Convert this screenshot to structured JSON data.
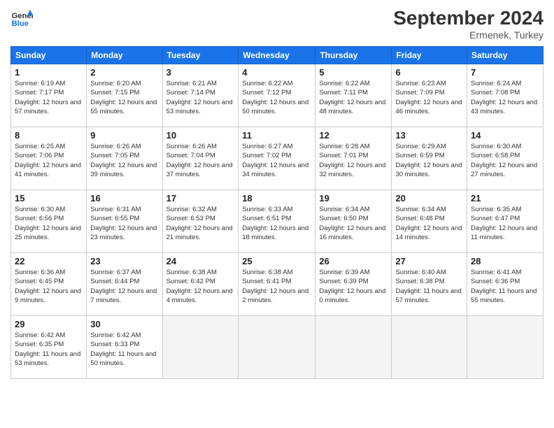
{
  "header": {
    "logo_line1": "General",
    "logo_line2": "Blue",
    "month_title": "September 2024",
    "location": "Ermenek, Turkey"
  },
  "weekdays": [
    "Sunday",
    "Monday",
    "Tuesday",
    "Wednesday",
    "Thursday",
    "Friday",
    "Saturday"
  ],
  "days": [
    {
      "num": "1",
      "sunrise": "6:19 AM",
      "sunset": "7:17 PM",
      "daylight": "12 hours and 57 minutes."
    },
    {
      "num": "2",
      "sunrise": "6:20 AM",
      "sunset": "7:15 PM",
      "daylight": "12 hours and 55 minutes."
    },
    {
      "num": "3",
      "sunrise": "6:21 AM",
      "sunset": "7:14 PM",
      "daylight": "12 hours and 53 minutes."
    },
    {
      "num": "4",
      "sunrise": "6:22 AM",
      "sunset": "7:12 PM",
      "daylight": "12 hours and 50 minutes."
    },
    {
      "num": "5",
      "sunrise": "6:22 AM",
      "sunset": "7:11 PM",
      "daylight": "12 hours and 48 minutes."
    },
    {
      "num": "6",
      "sunrise": "6:23 AM",
      "sunset": "7:09 PM",
      "daylight": "12 hours and 46 minutes."
    },
    {
      "num": "7",
      "sunrise": "6:24 AM",
      "sunset": "7:08 PM",
      "daylight": "12 hours and 43 minutes."
    },
    {
      "num": "8",
      "sunrise": "6:25 AM",
      "sunset": "7:06 PM",
      "daylight": "12 hours and 41 minutes."
    },
    {
      "num": "9",
      "sunrise": "6:26 AM",
      "sunset": "7:05 PM",
      "daylight": "12 hours and 39 minutes."
    },
    {
      "num": "10",
      "sunrise": "6:26 AM",
      "sunset": "7:04 PM",
      "daylight": "12 hours and 37 minutes."
    },
    {
      "num": "11",
      "sunrise": "6:27 AM",
      "sunset": "7:02 PM",
      "daylight": "12 hours and 34 minutes."
    },
    {
      "num": "12",
      "sunrise": "6:28 AM",
      "sunset": "7:01 PM",
      "daylight": "12 hours and 32 minutes."
    },
    {
      "num": "13",
      "sunrise": "6:29 AM",
      "sunset": "6:59 PM",
      "daylight": "12 hours and 30 minutes."
    },
    {
      "num": "14",
      "sunrise": "6:30 AM",
      "sunset": "6:58 PM",
      "daylight": "12 hours and 27 minutes."
    },
    {
      "num": "15",
      "sunrise": "6:30 AM",
      "sunset": "6:56 PM",
      "daylight": "12 hours and 25 minutes."
    },
    {
      "num": "16",
      "sunrise": "6:31 AM",
      "sunset": "6:55 PM",
      "daylight": "12 hours and 23 minutes."
    },
    {
      "num": "17",
      "sunrise": "6:32 AM",
      "sunset": "6:53 PM",
      "daylight": "12 hours and 21 minutes."
    },
    {
      "num": "18",
      "sunrise": "6:33 AM",
      "sunset": "6:51 PM",
      "daylight": "12 hours and 18 minutes."
    },
    {
      "num": "19",
      "sunrise": "6:34 AM",
      "sunset": "6:50 PM",
      "daylight": "12 hours and 16 minutes."
    },
    {
      "num": "20",
      "sunrise": "6:34 AM",
      "sunset": "6:48 PM",
      "daylight": "12 hours and 14 minutes."
    },
    {
      "num": "21",
      "sunrise": "6:35 AM",
      "sunset": "6:47 PM",
      "daylight": "12 hours and 11 minutes."
    },
    {
      "num": "22",
      "sunrise": "6:36 AM",
      "sunset": "6:45 PM",
      "daylight": "12 hours and 9 minutes."
    },
    {
      "num": "23",
      "sunrise": "6:37 AM",
      "sunset": "6:44 PM",
      "daylight": "12 hours and 7 minutes."
    },
    {
      "num": "24",
      "sunrise": "6:38 AM",
      "sunset": "6:42 PM",
      "daylight": "12 hours and 4 minutes."
    },
    {
      "num": "25",
      "sunrise": "6:38 AM",
      "sunset": "6:41 PM",
      "daylight": "12 hours and 2 minutes."
    },
    {
      "num": "26",
      "sunrise": "6:39 AM",
      "sunset": "6:39 PM",
      "daylight": "12 hours and 0 minutes."
    },
    {
      "num": "27",
      "sunrise": "6:40 AM",
      "sunset": "6:38 PM",
      "daylight": "11 hours and 57 minutes."
    },
    {
      "num": "28",
      "sunrise": "6:41 AM",
      "sunset": "6:36 PM",
      "daylight": "11 hours and 55 minutes."
    },
    {
      "num": "29",
      "sunrise": "6:42 AM",
      "sunset": "6:35 PM",
      "daylight": "11 hours and 53 minutes."
    },
    {
      "num": "30",
      "sunrise": "6:42 AM",
      "sunset": "6:33 PM",
      "daylight": "11 hours and 50 minutes."
    }
  ]
}
